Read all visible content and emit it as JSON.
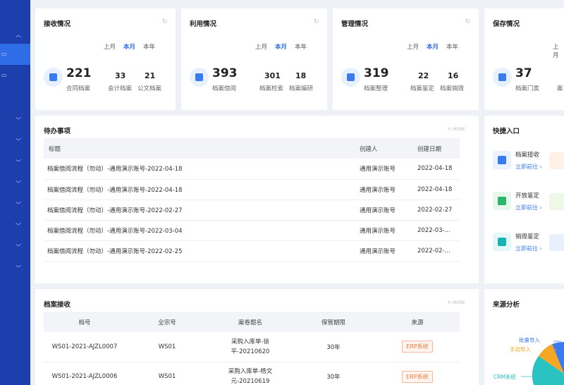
{
  "stats": {
    "receive": {
      "title": "接收情况",
      "periods": [
        "上月",
        "本月",
        "本年"
      ],
      "active_period": "本月",
      "main_value": "221",
      "main_label": "合同档案",
      "sub1_value": "33",
      "sub1_label": "会计档案",
      "sub2_value": "21",
      "sub2_label": "公文档案"
    },
    "usage": {
      "title": "利用情况",
      "periods": [
        "上月",
        "本月",
        "本年"
      ],
      "active_period": "本月",
      "main_value": "393",
      "main_label": "档案借阅",
      "sub1_value": "301",
      "sub1_label": "档案检索",
      "sub2_value": "18",
      "sub2_label": "档案编研"
    },
    "manage": {
      "title": "管理情况",
      "periods": [
        "上月",
        "本月",
        "本年"
      ],
      "active_period": "本月",
      "main_value": "319",
      "main_label": "档案整理",
      "sub1_value": "22",
      "sub1_label": "档案鉴定",
      "sub2_value": "16",
      "sub2_label": "档案销毁"
    },
    "storage": {
      "title": "保存情况",
      "periods": [
        "上月"
      ],
      "main_value": "37",
      "main_label": "档案门类",
      "sub1_label": "案"
    }
  },
  "todo": {
    "title": "待办事项",
    "more": "MORE",
    "columns": [
      "标题",
      "创建人",
      "创建日期"
    ],
    "rows": [
      {
        "title": "档案借阅流程（勿动）-通用演示账号-2022-04-18",
        "creator": "通用演示账号",
        "date": "2022-04-18"
      },
      {
        "title": "档案借阅流程（勿动）-通用演示账号-2022-04-18",
        "creator": "通用演示账号",
        "date": "2022-04-18"
      },
      {
        "title": "档案借阅流程（勿动）-通用演示账号-2022-02-27",
        "creator": "通用演示账号",
        "date": "2022-02-27"
      },
      {
        "title": "档案借阅流程（勿动）-通用演示账号-2022-03-04",
        "creator": "通用演示账号",
        "date": "2022-03-..."
      },
      {
        "title": "档案借阅流程（勿动）-通用演示账号-2022-02-25",
        "creator": "通用演示账号",
        "date": "2022-02-..."
      }
    ]
  },
  "quick": {
    "title": "快捷入口",
    "items": [
      {
        "name": "档案接收",
        "link": "立即前往 ›"
      },
      {
        "name": "开放鉴定",
        "link": "立即前往 ›"
      },
      {
        "name": "销毁鉴定",
        "link": "立即前往 ›"
      }
    ]
  },
  "archive": {
    "title": "档案接收",
    "more": "MORE",
    "columns": [
      "档号",
      "全宗号",
      "案卷题名",
      "保管期限",
      "来源"
    ],
    "rows": [
      {
        "code": "WS01-2021-AJZL0007",
        "fonds": "WS01",
        "name1": "采购入库单-徐",
        "name2": "平-20210620",
        "term": "30年",
        "source": "ERP系统"
      },
      {
        "code": "WS01-2021-AJZL0006",
        "fonds": "WS01",
        "name1": "采购入库单-杨文",
        "name2": "元-20210619",
        "term": "30年",
        "source": "ERP系统"
      }
    ]
  },
  "source_analysis": {
    "title": "来源分析",
    "labels": [
      "批量导入",
      "手动导入",
      "CRM系统"
    ]
  },
  "colors": {
    "sidebar": "#1d3fae",
    "accent": "#2f6de6",
    "tag": "#f07a3c"
  }
}
